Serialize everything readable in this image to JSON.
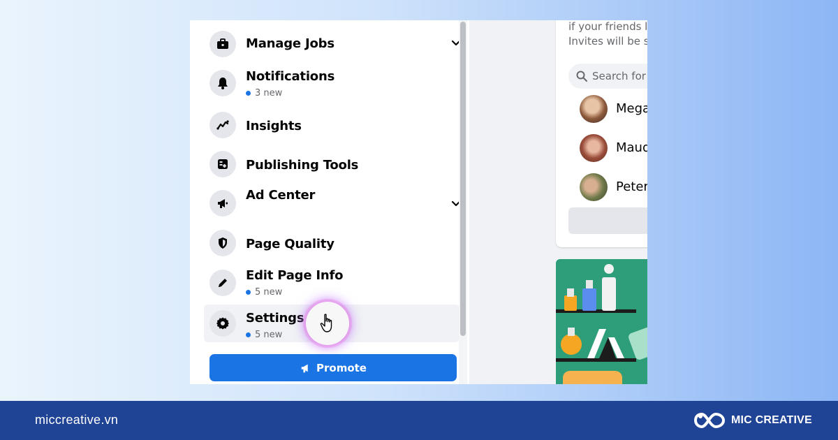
{
  "sidebar": {
    "items": [
      {
        "label": "Manage Jobs",
        "icon": "briefcase-icon",
        "sub": "",
        "expandable": true
      },
      {
        "label": "Notifications",
        "icon": "bell-icon",
        "sub": "3 new",
        "expandable": false
      },
      {
        "label": "Insights",
        "icon": "insights-icon",
        "sub": "",
        "expandable": false
      },
      {
        "label": "Publishing Tools",
        "icon": "publishing-tools-icon",
        "sub": "",
        "expandable": false
      },
      {
        "label": "Ad Center",
        "icon": "megaphone-icon",
        "sub": "",
        "expandable": true
      },
      {
        "label": "Page Quality",
        "icon": "shield-icon",
        "sub": "",
        "expandable": false
      },
      {
        "label": "Edit Page Info",
        "icon": "pencil-icon",
        "sub": "5 new",
        "expandable": false
      },
      {
        "label": "Settings",
        "icon": "gear-icon",
        "sub": "5 new",
        "expandable": false
      }
    ],
    "promote_label": "Promote"
  },
  "right_panel": {
    "invite_line1": "if your friends lik",
    "invite_line2": "Invites will be se",
    "search_placeholder": "Search for f",
    "friends": [
      {
        "name": "Mega"
      },
      {
        "name": "Maud"
      },
      {
        "name": "Peter"
      }
    ]
  },
  "footer": {
    "url": "miccreative.vn",
    "brand": "MIC CREATIVE"
  },
  "colors": {
    "accent": "#1b74e4",
    "footer_bg": "#1f4496",
    "notification_dot": "#1b74e4"
  }
}
